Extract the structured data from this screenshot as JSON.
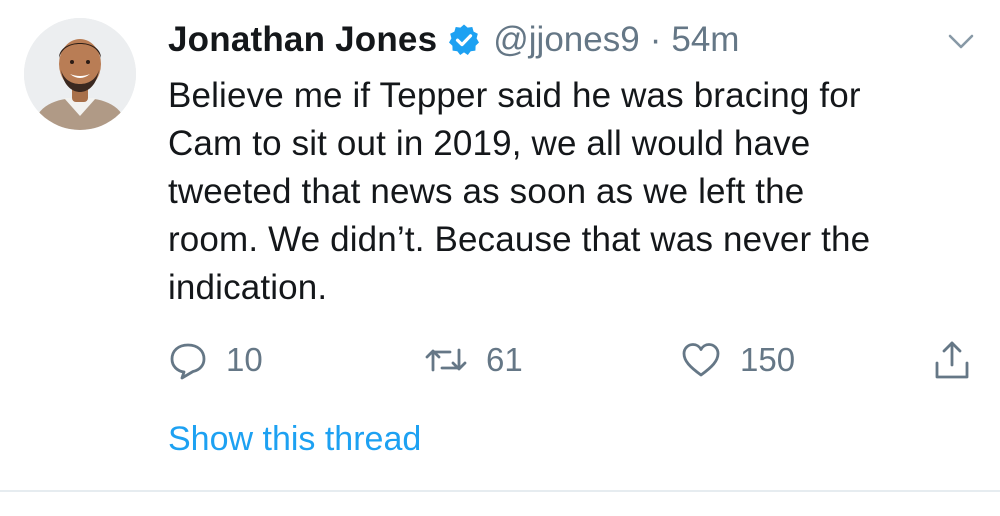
{
  "tweet": {
    "author": {
      "name": "Jonathan Jones",
      "handle": "@jjones9",
      "verified": true,
      "avatar": "profile-photo"
    },
    "separator": "·",
    "time": "54m",
    "text": "Believe me if Tepper said he was bracing for\nCam to sit out in 2019, we all would have\ntweeted that news as soon as we left the\nroom. We didn’t. Because that was never the\nindication.",
    "actions": {
      "reply": {
        "icon": "reply-icon",
        "count": "10"
      },
      "retweet": {
        "icon": "retweet-icon",
        "count": "61"
      },
      "like": {
        "icon": "heart-icon",
        "count": "150"
      },
      "share": {
        "icon": "share-icon"
      }
    },
    "thread_link": "Show this thread",
    "menu_icon": "chevron-down-icon"
  },
  "colors": {
    "text": "#14171a",
    "secondary": "#657786",
    "link": "#1da1f2",
    "verified": "#1da1f2",
    "divider": "#e6ecf0"
  }
}
